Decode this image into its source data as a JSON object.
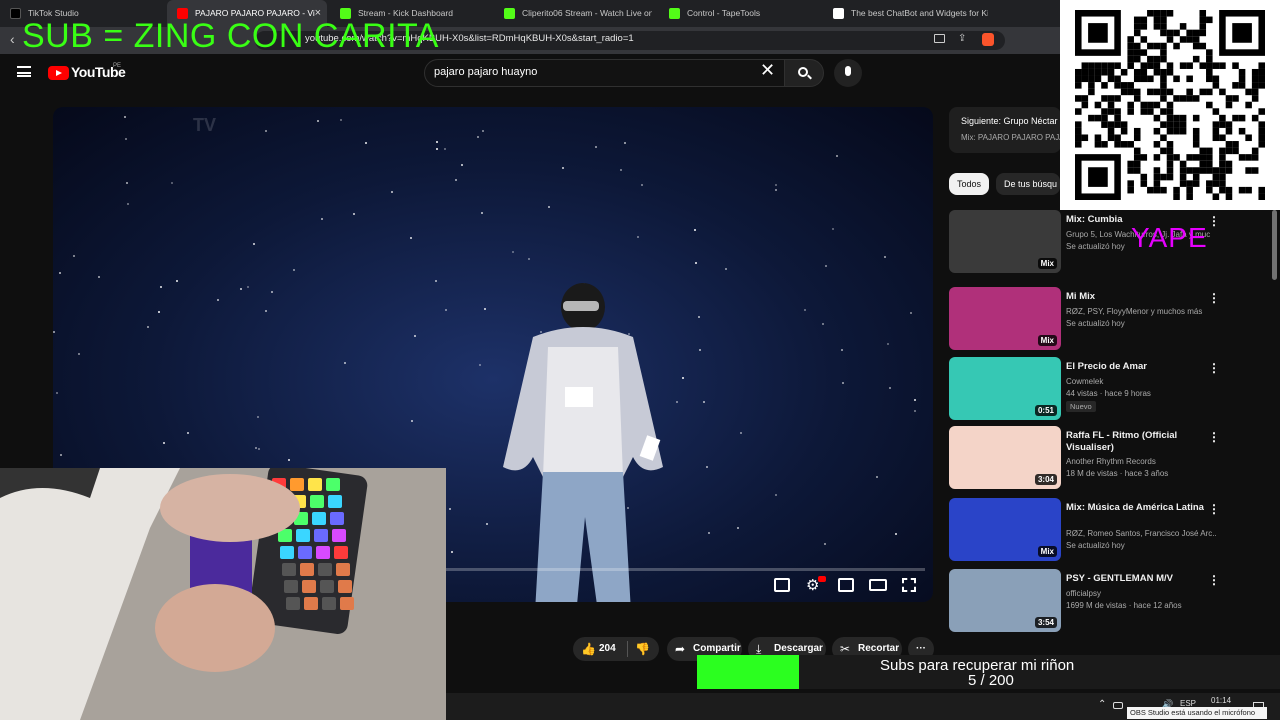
{
  "browser": {
    "tabs": [
      {
        "label": "TikTok Studio",
        "icon": "tiktok-icon",
        "color": "#000000"
      },
      {
        "label": "PAJARO PAJARO PAJARO - Vi",
        "icon": "youtube-icon",
        "color": "#ff0000",
        "active": true
      },
      {
        "label": "Stream - Kick Dashboard",
        "icon": "kick-icon",
        "color": "#53fc18"
      },
      {
        "label": "Cliperito06 Stream - Watch Live on K",
        "icon": "kick-icon",
        "color": "#53fc18"
      },
      {
        "label": "Control - TapeTools",
        "icon": "kick-icon",
        "color": "#53fc18"
      },
      {
        "label": "The best ChatBot and Widgets for Ki",
        "icon": "diamond-icon",
        "color": "#ffffff"
      }
    ],
    "url": "youtube.com/watch?v=mHqKBUH-X0s&list=RDmHqKBUH-X0s&start_radio=1"
  },
  "overlay": {
    "sub_text": "SUB = ZING CON CARITA",
    "yape": "YAPE",
    "goal_title": "Subs para recuperar mi riñon",
    "goal_count": "5 / 200",
    "goal_fraction": 0.025
  },
  "youtube": {
    "logo_text": "YouTube",
    "country": "PE",
    "search_value": "pajaro pajaro huayno"
  },
  "actions": {
    "likes": "204",
    "share": "Compartir",
    "download": "Descargar",
    "clip": "Recortar"
  },
  "sidebar": {
    "next_title": "Siguiente: Grupo Néctar",
    "next_sub": "Mix: PAJARO PAJARO PAJA",
    "chips": [
      "Todos",
      "De tus búsqu"
    ],
    "items": [
      {
        "title": "Mix: Cumbia",
        "line1": "Grupo 5, Los Wachiturros, Jj. Jafa y muc",
        "line2": "Se actualizó hoy",
        "badge": "Mix",
        "thumb": "#3a3a3a"
      },
      {
        "title": "Mi Mix",
        "line1": "RØZ, PSY, FloyyMenor y muchos más",
        "line2": "Se actualizó hoy",
        "badge": "Mix",
        "thumb": "#b0307a"
      },
      {
        "title": "El Precio de Amar",
        "line1": "Cowmelek",
        "line2": "44 vistas · hace 9 horas",
        "badge": "0:51",
        "tag": "Nuevo",
        "thumb": "#36c8b4"
      },
      {
        "title": "Raffa FL - Ritmo (Official Visualiser)",
        "line1": "Another Rhythm Records",
        "line2": "18 M de vistas · hace 3 años",
        "badge": "3:04",
        "thumb": "#f4d4c8"
      },
      {
        "title": "Mix: Música de América Latina",
        "line1": "RØZ, Romeo Santos, Francisco José Arc...",
        "line2": "Se actualizó hoy",
        "badge": "Mix",
        "thumb": "#2a44c8"
      },
      {
        "title": "PSY - GENTLEMAN M/V",
        "line1": "officialpsy",
        "line2": "1699 M de vistas · hace 12 años",
        "badge": "3:54",
        "thumb": "#8aa0b8"
      }
    ]
  },
  "taskbar": {
    "lang": "ESP",
    "time": "01:14",
    "tooltip": "OBS Studio está usando el micrófono"
  }
}
